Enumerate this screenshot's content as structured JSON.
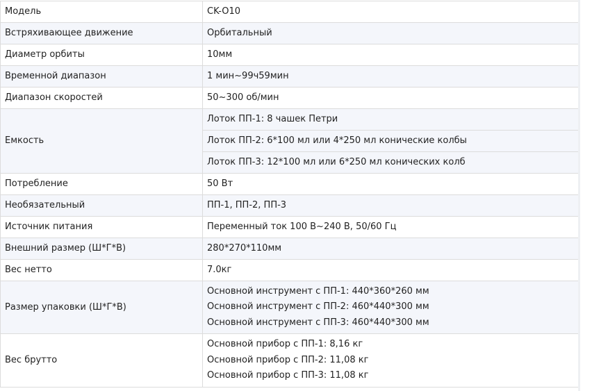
{
  "spec_table": {
    "rows": {
      "model": {
        "label": "Модель",
        "value": "CK-O10"
      },
      "shaking_motion": {
        "label": "Встряхивающее движение",
        "value": "Орбитальный"
      },
      "orbit_diameter": {
        "label": "Диаметр орбиты",
        "value": "10мм"
      },
      "time_range": {
        "label": "Временной диапазон",
        "value": "1 мин~99ч59мин"
      },
      "speed_range": {
        "label": "Диапазон скоростей",
        "value": "50~300 об/мин"
      },
      "capacity": {
        "label": "Емкость",
        "values": [
          "Лоток ПП-1: 8 чашек Петри",
          "Лоток ПП-2: 6*100 мл или 4*250 мл конические колбы",
          "Лоток ПП-3: 12*100 мл или 6*250 мл конических колб"
        ]
      },
      "power_consumption": {
        "label": "Потребление",
        "value": "50 Вт"
      },
      "optional": {
        "label": "Необязательный",
        "value": "ПП-1, ПП-2, ПП-3"
      },
      "power_supply": {
        "label": "Источник питания",
        "value": "Переменный ток 100 В~240 В, 50/60 Гц"
      },
      "external_size": {
        "label": "Внешний размер (Ш*Г*В)",
        "value": "280*270*110мм"
      },
      "net_weight": {
        "label": "Вес нетто",
        "value": "7.0кг"
      },
      "package_size": {
        "label": "Размер упаковки (Ш*Г*В)",
        "values": [
          "Основной инструмент с ПП-1: 440*360*260 мм",
          "Основной инструмент с ПП-2: 460*440*300 мм",
          "Основной инструмент с ПП-3: 460*440*300 мм"
        ]
      },
      "gross_weight": {
        "label": "Вес брутто",
        "values": [
          "Основной прибор с ПП-1: 8,16 кг",
          "Основной прибор с ПП-2: 11,08 кг",
          "Основной прибор с ПП-3: 11,08 кг"
        ]
      }
    }
  }
}
